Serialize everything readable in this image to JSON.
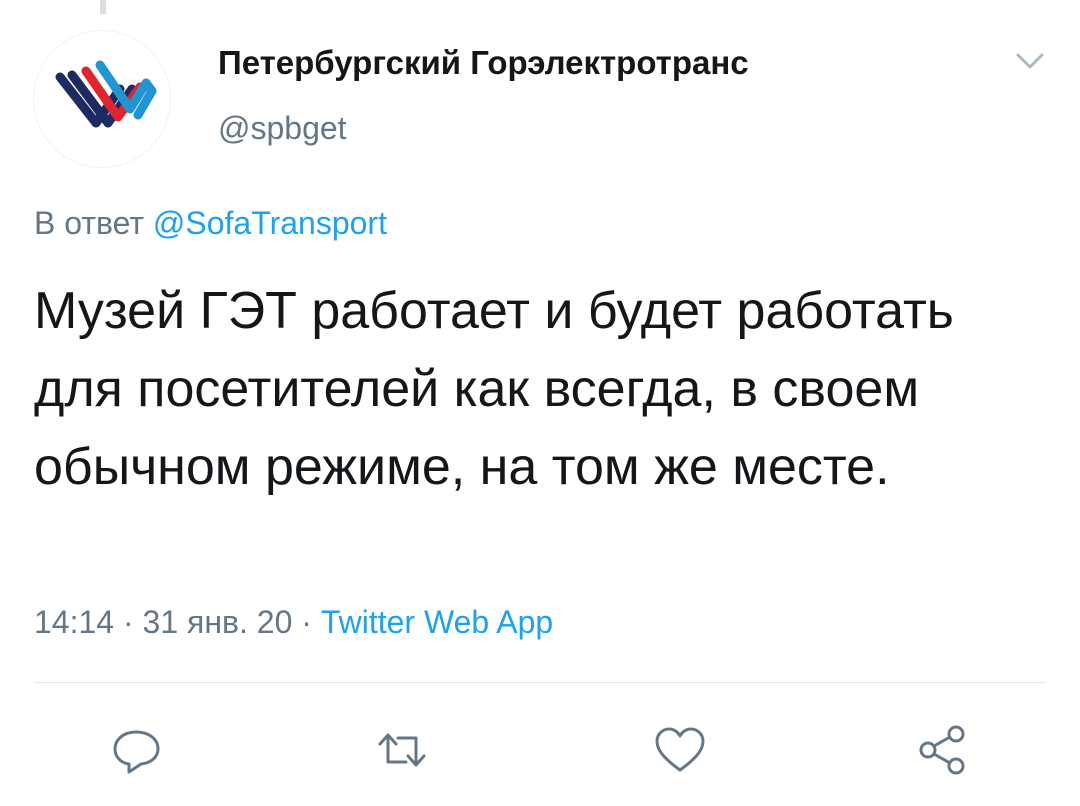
{
  "tweet": {
    "author": {
      "display_name": "Петербургский Горэлектротранс",
      "handle": "@spbget",
      "avatar_icon": "spbget-logo-icon"
    },
    "reply": {
      "prefix": "В ответ",
      "mention": "@SofaTransport"
    },
    "text": "Музей ГЭТ работает и будет работать для посетителей как всегда, в своем обычном режиме, на том же месте.",
    "time": "14:14",
    "date": "31 янв. 20",
    "separator": "·",
    "source": "Twitter Web App"
  },
  "actions": [
    "reply-icon",
    "retweet-icon",
    "like-icon",
    "share-icon"
  ],
  "colors": {
    "text": "#14171a",
    "muted": "#657786",
    "link": "#1da1f2",
    "logo_navy": "#1e2b63",
    "logo_red": "#e3232d",
    "logo_blue": "#1f96d3"
  }
}
